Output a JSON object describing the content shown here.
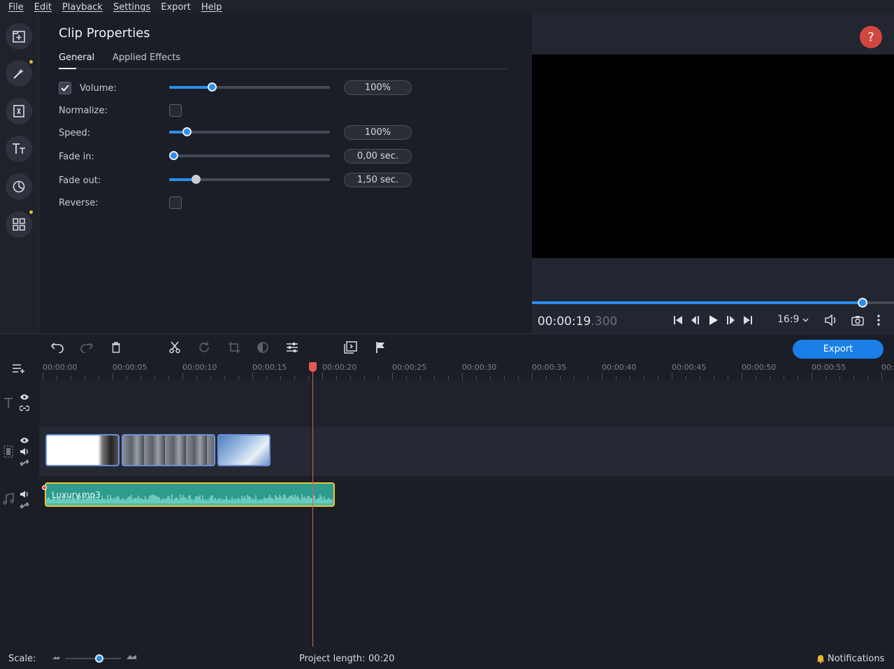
{
  "menu": [
    "File",
    "Edit",
    "Playback",
    "Settings",
    "Export",
    "Help"
  ],
  "sidebar": {
    "items": [
      {
        "icon": "import-icon"
      },
      {
        "icon": "magic-wand-icon",
        "dot": true
      },
      {
        "icon": "transitions-icon"
      },
      {
        "icon": "titles-icon"
      },
      {
        "icon": "stickers-icon"
      },
      {
        "icon": "more-tools-icon",
        "dot": true
      }
    ],
    "dot_color": "#e8b43c"
  },
  "clip_properties": {
    "title": "Clip Properties",
    "tabs": [
      {
        "label": "General",
        "active": true
      },
      {
        "label": "Applied Effects",
        "active": false
      }
    ],
    "rows": {
      "volume": {
        "label": "Volume:",
        "checked": true,
        "value": "100%",
        "level": 0.26
      },
      "normalize": {
        "label": "Normalize:",
        "checked": false
      },
      "speed": {
        "label": "Speed:",
        "value": "100%",
        "level": 0.11
      },
      "fade_in": {
        "label": "Fade in:",
        "value": "0,00 sec.",
        "level": 0.02
      },
      "fade_out": {
        "label": "Fade out:",
        "value": "1,50 sec.",
        "level": 0.17
      },
      "reverse": {
        "label": "Reverse:",
        "checked": false
      }
    }
  },
  "preview": {
    "help": "?",
    "timecode_main": "00:00:19",
    "timecode_ms": ".300",
    "aspect": "16:9",
    "progress": 0.915
  },
  "toolbar": {
    "export_label": "Export",
    "accent": "#1a7fe6"
  },
  "timeline": {
    "ticks": [
      "00:00:00",
      "00:00:05",
      "00:00:10",
      "00:00:15",
      "00:00:20",
      "00:00:25",
      "00:00:30",
      "00:00:35",
      "00:00:40",
      "00:00:45",
      "00:00:50",
      "00:00:55",
      "00:"
    ],
    "audio_clip": "Luxury.mp3",
    "playhead_color": "#e05a52"
  },
  "status": {
    "scale_label": "Scale:",
    "project_length_label": "Project length:",
    "project_length_value": "00:20",
    "notifications": "Notifications"
  }
}
